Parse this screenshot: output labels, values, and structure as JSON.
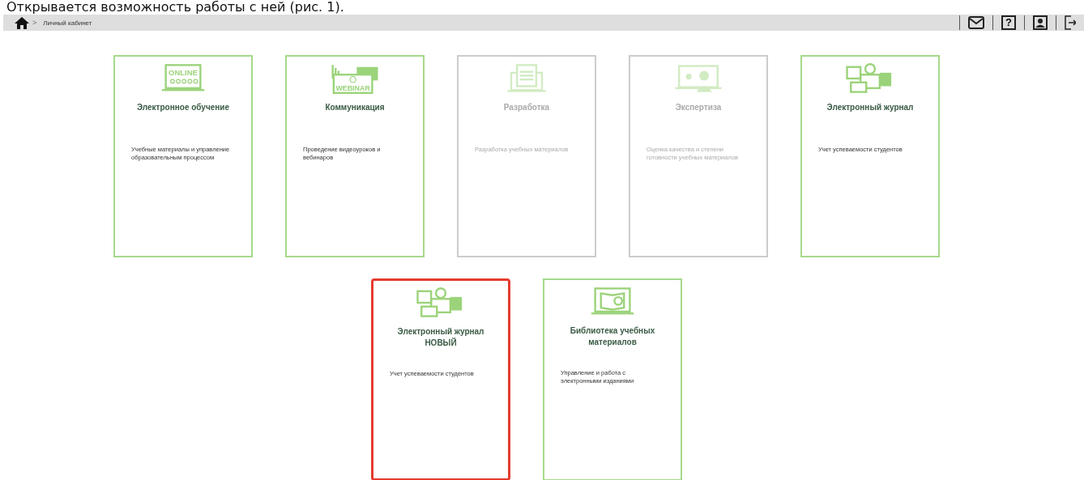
{
  "caption": "Открывается возможность работы с ней (рис. 1).",
  "breadcrumb": {
    "separator": ">",
    "items": [
      "Личный кабинет"
    ]
  },
  "toolbar": [
    {
      "kind": "mail"
    },
    {
      "kind": "help",
      "text": "?"
    },
    {
      "kind": "profile"
    },
    {
      "kind": "logout"
    }
  ],
  "rows": [
    [
      {
        "title": "Электронное обучение",
        "description": "Учебные материалы и управление образовательным процессом",
        "icon_label": "ONLINE",
        "disabled": false,
        "highlighted": false
      },
      {
        "title": "Коммуникация",
        "description": "Проведение видеоуроков и вебинаров",
        "icon_label": "WEBINAR",
        "disabled": false,
        "highlighted": false
      },
      {
        "title": "Разработка",
        "description": "Разработка учебных материалов",
        "disabled": true,
        "highlighted": false
      },
      {
        "title": "Экспертиза",
        "description": "Оценка качества и степени готовности учебных материалов",
        "disabled": true,
        "highlighted": false
      },
      {
        "title": "Электронный журнал",
        "description": "Учет успеваемости студентов",
        "disabled": false,
        "highlighted": false
      }
    ],
    [
      {
        "title": "Электронный журнал НОВЫЙ",
        "description": "Учет успеваемости студентов",
        "disabled": false,
        "highlighted": true
      },
      {
        "title": "Библиотека учебных материалов",
        "description": "Управление и работа с электронными изданиями",
        "disabled": false,
        "highlighted": false
      }
    ]
  ]
}
